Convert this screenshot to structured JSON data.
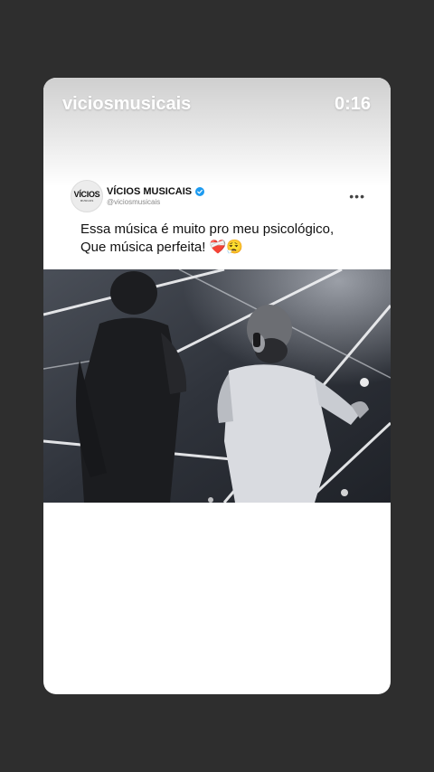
{
  "story": {
    "username": "viciosmusicais",
    "elapsed": "0:16"
  },
  "post": {
    "avatar_text": "VÍCIOS",
    "avatar_subtext": "MUSICAIS",
    "display_name": "VÍCIOS MUSICAIS",
    "handle": "@viciosmusicais",
    "caption_line1": "Essa música é muito pro meu psicológico,",
    "caption_line2": "Que música perfeita!",
    "caption_emoji_1": "❤️‍🩹",
    "caption_emoji_2": "😮‍💨"
  },
  "colors": {
    "background": "#2e2e2e",
    "verified": "#1d9bf0"
  }
}
